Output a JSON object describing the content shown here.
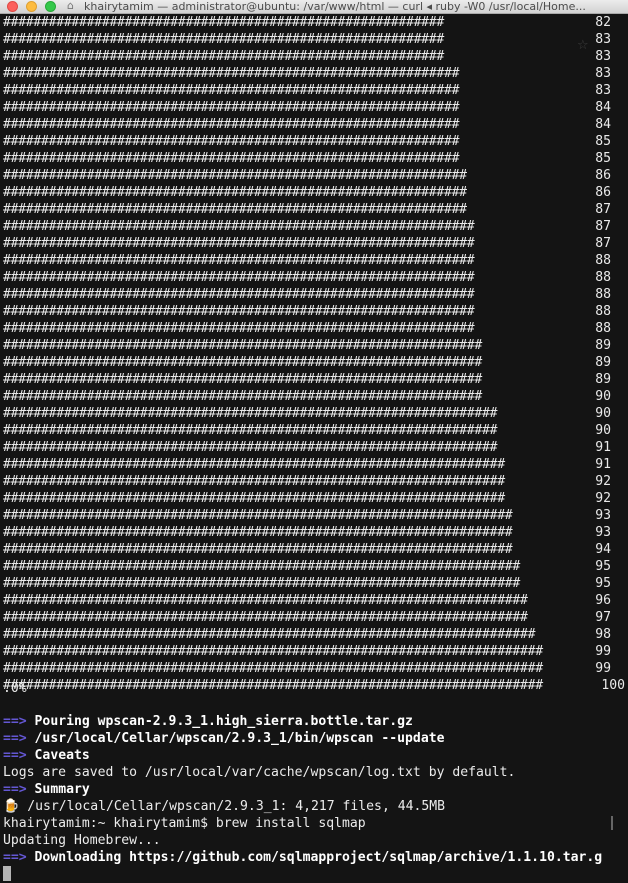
{
  "window": {
    "title": "khairytamim — administrator@ubuntu: /var/www/html — curl ◂ ruby -W0 /usr/local/Home..."
  },
  "progress": {
    "lines": [
      {
        "percent": "82",
        "fill": 0.749
      },
      {
        "percent": "83",
        "fill": 0.749
      },
      {
        "percent": "83",
        "fill": 0.749
      },
      {
        "percent": "83",
        "fill": 0.763
      },
      {
        "percent": "83",
        "fill": 0.763
      },
      {
        "percent": "84",
        "fill": 0.763
      },
      {
        "percent": "84",
        "fill": 0.775
      },
      {
        "percent": "85",
        "fill": 0.775
      },
      {
        "percent": "85",
        "fill": 0.775
      },
      {
        "percent": "86",
        "fill": 0.788
      },
      {
        "percent": "86",
        "fill": 0.788
      },
      {
        "percent": "87",
        "fill": 0.788
      },
      {
        "percent": "87",
        "fill": 0.801
      },
      {
        "percent": "87",
        "fill": 0.801
      },
      {
        "percent": "88",
        "fill": 0.801
      },
      {
        "percent": "88",
        "fill": 0.801
      },
      {
        "percent": "88",
        "fill": 0.801
      },
      {
        "percent": "88",
        "fill": 0.801
      },
      {
        "percent": "88",
        "fill": 0.801
      },
      {
        "percent": "89",
        "fill": 0.814
      },
      {
        "percent": "89",
        "fill": 0.814
      },
      {
        "percent": "89",
        "fill": 0.814
      },
      {
        "percent": "90",
        "fill": 0.814
      },
      {
        "percent": "90",
        "fill": 0.827
      },
      {
        "percent": "90",
        "fill": 0.827
      },
      {
        "percent": "91",
        "fill": 0.827
      },
      {
        "percent": "91",
        "fill": 0.84
      },
      {
        "percent": "92",
        "fill": 0.84
      },
      {
        "percent": "92",
        "fill": 0.84
      },
      {
        "percent": "93",
        "fill": 0.853
      },
      {
        "percent": "93",
        "fill": 0.853
      },
      {
        "percent": "94",
        "fill": 0.853
      },
      {
        "percent": "95",
        "fill": 0.866
      },
      {
        "percent": "95",
        "fill": 0.866
      },
      {
        "percent": "96",
        "fill": 0.879
      },
      {
        "percent": "97",
        "fill": 0.879
      },
      {
        "percent": "98",
        "fill": 0.892
      },
      {
        "percent": "99",
        "fill": 0.904
      },
      {
        "percent": "99",
        "fill": 0.904
      },
      {
        "percent": "100",
        "fill": 0.916
      }
    ],
    "trailing": ".0%"
  },
  "output": {
    "pour_arrow": "==>",
    "pour_text": "Pouring wpscan-2.9.3_1.high_sierra.bottle.tar.gz",
    "update_arrow": "==>",
    "update_text": "/usr/local/Cellar/wpscan/2.9.3_1/bin/wpscan --update",
    "caveats_arrow": "==>",
    "caveats_text": "Caveats",
    "logs_text": "Logs are saved to /usr/local/var/cache/wpscan/log.txt by default.",
    "summary_arrow": "==>",
    "summary_text": "Summary",
    "beer_glyph": "🍺",
    "cellar_text": "/usr/local/Cellar/wpscan/2.9.3_1: 4,217 files, 44.5MB",
    "prompt_text": "khairytamim:~ khairytamim$ brew install sqlmap",
    "updating_text": "Updating Homebrew...",
    "download_arrow": "==>",
    "download_text": "Downloading https://github.com/sqlmapproject/sqlmap/archive/1.1.10.tar.g"
  },
  "colors": {
    "terminal_bg": "#141414",
    "arrow": "#6457d4",
    "beer": "#e0a52c"
  }
}
